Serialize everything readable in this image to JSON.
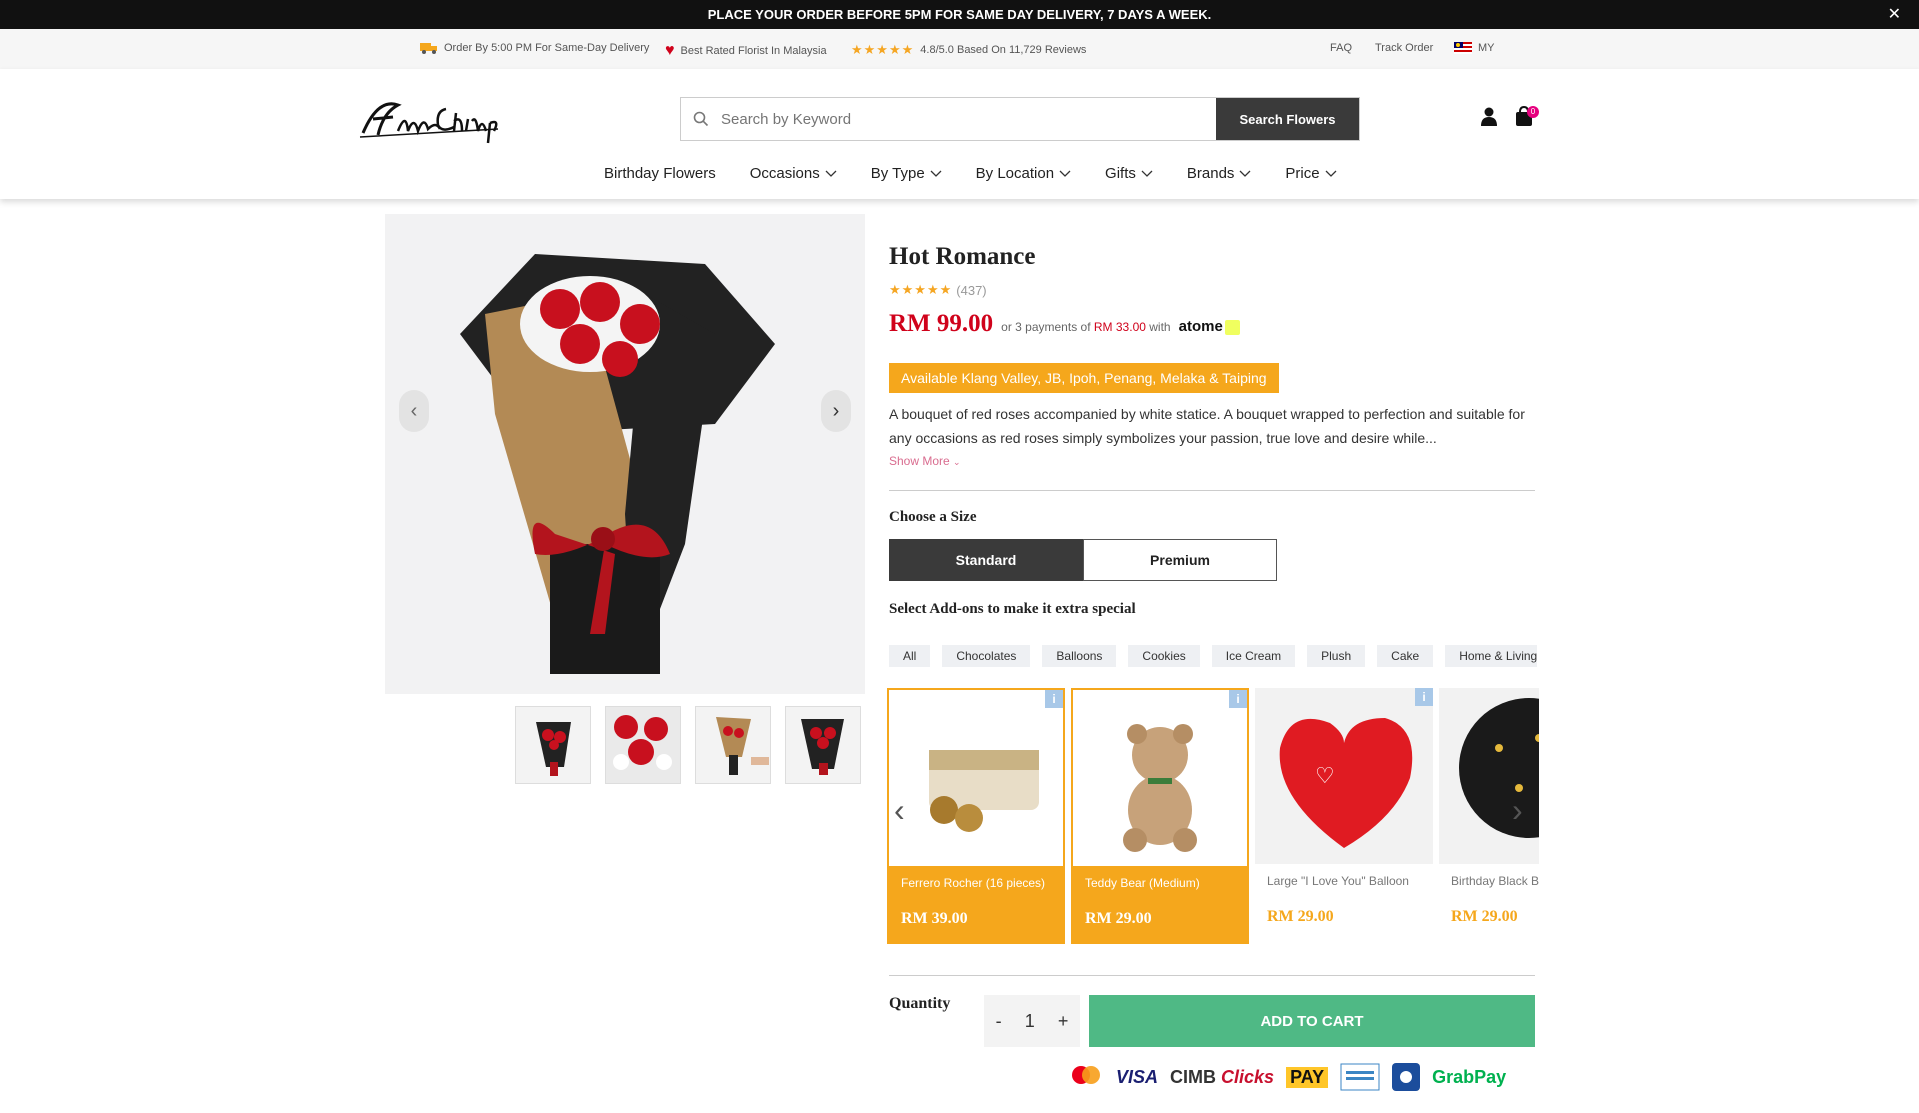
{
  "topbar": {
    "message": "PLACE YOUR ORDER BEFORE 5PM FOR SAME DAY DELIVERY, 7 DAYS A WEEK.",
    "close": "✕"
  },
  "infobar": {
    "delivery": "Order By 5:00 PM For Same-Day Delivery",
    "florist": "Best Rated Florist In Malaysia",
    "stars": "★★★★★",
    "reviews": "4.8/5.0 Based On 11,729 Reviews",
    "faq": "FAQ",
    "track": "Track Order",
    "country": "MY"
  },
  "search": {
    "placeholder": "Search by Keyword",
    "button": "Search Flowers"
  },
  "cart": {
    "count": "0"
  },
  "nav": {
    "birthday": "Birthday Flowers",
    "occasions": "Occasions",
    "bytype": "By Type",
    "bylocation": "By Location",
    "gifts": "Gifts",
    "brands": "Brands",
    "price": "Price"
  },
  "product": {
    "title": "Hot Romance",
    "stars": "★★★★★",
    "reviews": "(437)",
    "price": "RM 99.00",
    "installment_pre": "or 3 payments of",
    "installment_amount": "RM 33.00",
    "installment_post": "with",
    "atome": "atome",
    "availability": "Available Klang Valley, JB, Ipoh, Penang, Melaka & Taiping",
    "description": "A bouquet of red roses accompanied by white statice. A bouquet wrapped to perfection and suitable for any occasions as red roses simply symbolizes your passion, true love and desire while...",
    "show_more": "Show More"
  },
  "size": {
    "label": "Choose a Size",
    "standard": "Standard",
    "premium": "Premium"
  },
  "addons": {
    "title": "Select Add-ons to make it extra special",
    "categories": [
      "All",
      "Chocolates",
      "Balloons",
      "Cookies",
      "Ice Cream",
      "Plush",
      "Cake",
      "Home & Living"
    ],
    "items": [
      {
        "name": "Ferrero Rocher (16 pieces)",
        "price": "RM 39.00"
      },
      {
        "name": "Teddy Bear (Medium)",
        "price": "RM 29.00"
      },
      {
        "name": "Large \"I Love You\" Balloon",
        "price": "RM 29.00"
      },
      {
        "name": "Birthday Black Balloon",
        "price": "RM 29.00"
      }
    ],
    "info_badge": "i"
  },
  "quantity": {
    "label": "Quantity",
    "minus": "-",
    "value": "1",
    "plus": "+"
  },
  "add_to_cart": "ADD TO CART",
  "payments": {
    "visa": "VISA",
    "cimb": "CIMB",
    "clicks": "Clicks",
    "maybank": "PAY",
    "grabpay": "GrabPay"
  },
  "colors": {
    "accent": "#f5a71c",
    "price": "#d0021b",
    "cart": "#4fb985",
    "dark": "#3a3a3a"
  }
}
